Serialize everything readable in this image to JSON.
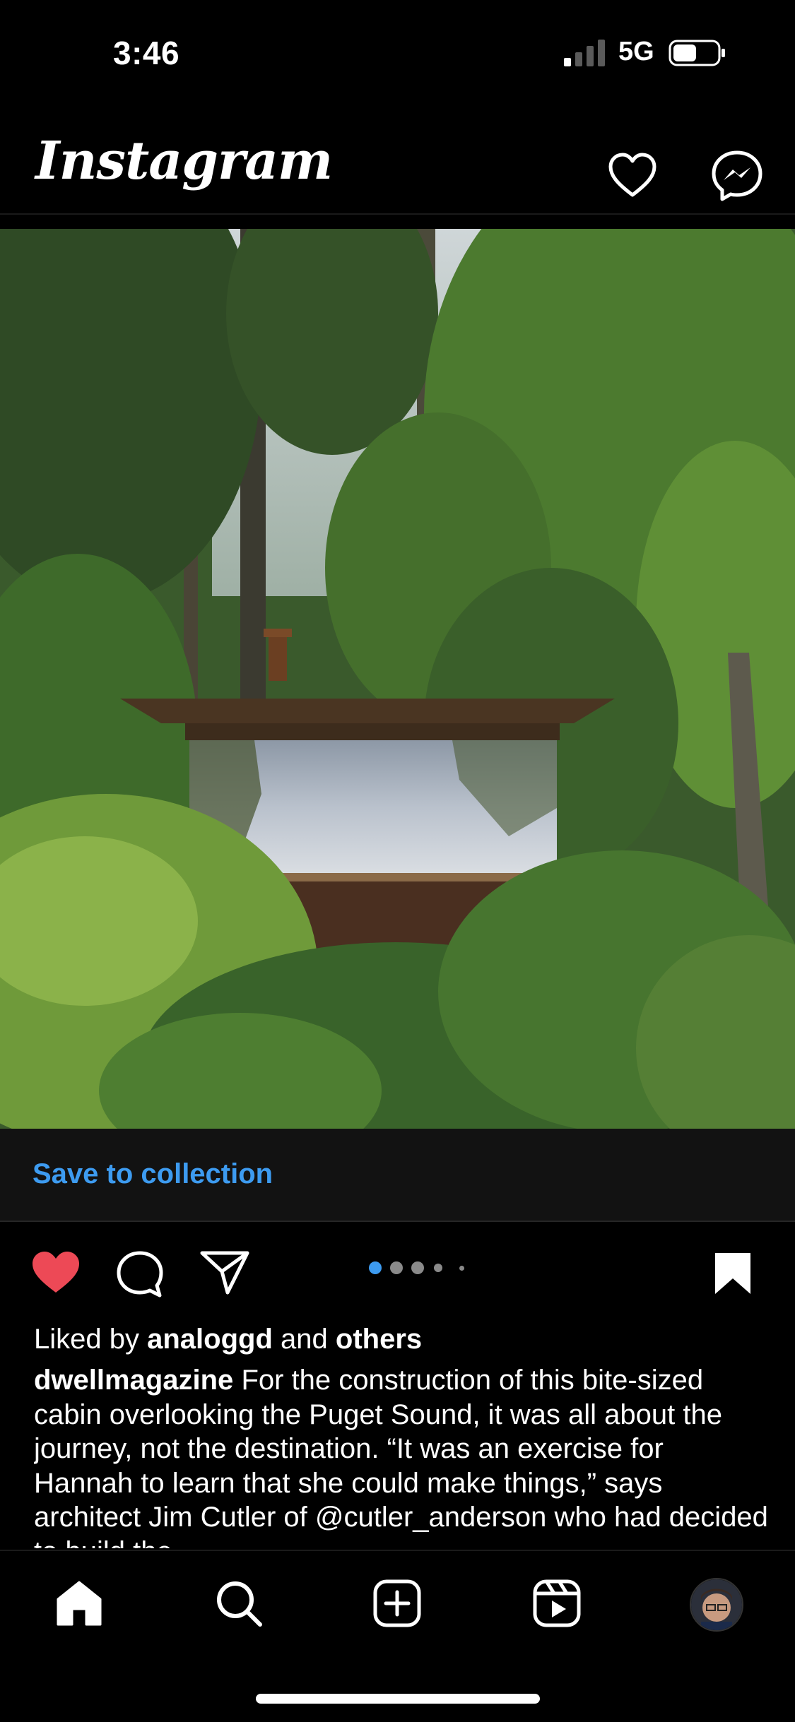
{
  "status_bar": {
    "time": "3:46",
    "network": "5G"
  },
  "header": {
    "logo": "Instagram"
  },
  "post": {
    "image_alt_icon": "photo-cabin",
    "save_banner": "Save to collection",
    "carousel": {
      "count": 5,
      "active_index": 0
    },
    "liked": true,
    "saved": true,
    "likes": {
      "prefix": "Liked by",
      "user": "analoggd",
      "joiner": "and",
      "others": "others"
    },
    "caption": {
      "username": "dwellmagazine",
      "text": "For the construction of this bite-sized cabin overlooking the Puget Sound, it was all about the journey, not the destination. “It was an exercise for Hannah to learn that she could make things,” says architect Jim Cutler of @cutler_anderson who had decided to build the"
    }
  },
  "nav": {
    "items": [
      "home-icon",
      "search-icon",
      "create-icon",
      "reels-icon",
      "profile-avatar"
    ],
    "active": "home-icon"
  },
  "colors": {
    "accent": "#3d9bf0",
    "like": "#ed4956",
    "background": "#000000"
  }
}
